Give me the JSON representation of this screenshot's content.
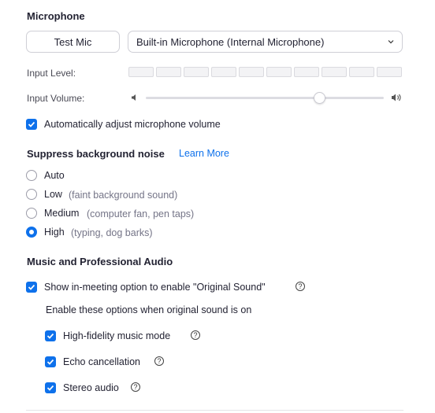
{
  "microphone": {
    "title": "Microphone",
    "test_button": "Test Mic",
    "device_selected": "Built-in Microphone (Internal Microphone)",
    "input_level_label": "Input Level:",
    "input_level_segments": 10,
    "input_level_active": 0,
    "input_volume_label": "Input Volume:",
    "input_volume_value": 0.73,
    "auto_adjust_label": "Automatically adjust microphone volume",
    "auto_adjust_checked": true
  },
  "noise": {
    "title": "Suppress background noise",
    "learn_more": "Learn More",
    "options": [
      {
        "label": "Auto",
        "hint": "",
        "selected": false
      },
      {
        "label": "Low",
        "hint": "(faint background sound)",
        "selected": false
      },
      {
        "label": "Medium",
        "hint": "(computer fan, pen taps)",
        "selected": false
      },
      {
        "label": "High",
        "hint": "(typing, dog barks)",
        "selected": true
      }
    ]
  },
  "music": {
    "title": "Music and Professional Audio",
    "original_sound_label": "Show in-meeting option to enable \"Original Sound\"",
    "original_sound_checked": true,
    "sub_heading": "Enable these options when original sound is on",
    "hifi_label": "High-fidelity music mode",
    "hifi_checked": true,
    "echo_label": "Echo cancellation",
    "echo_checked": true,
    "stereo_label": "Stereo audio",
    "stereo_checked": true,
    "help_glyph": "?"
  },
  "colors": {
    "accent": "#0e71eb",
    "text": "#232333",
    "muted": "#747487"
  }
}
